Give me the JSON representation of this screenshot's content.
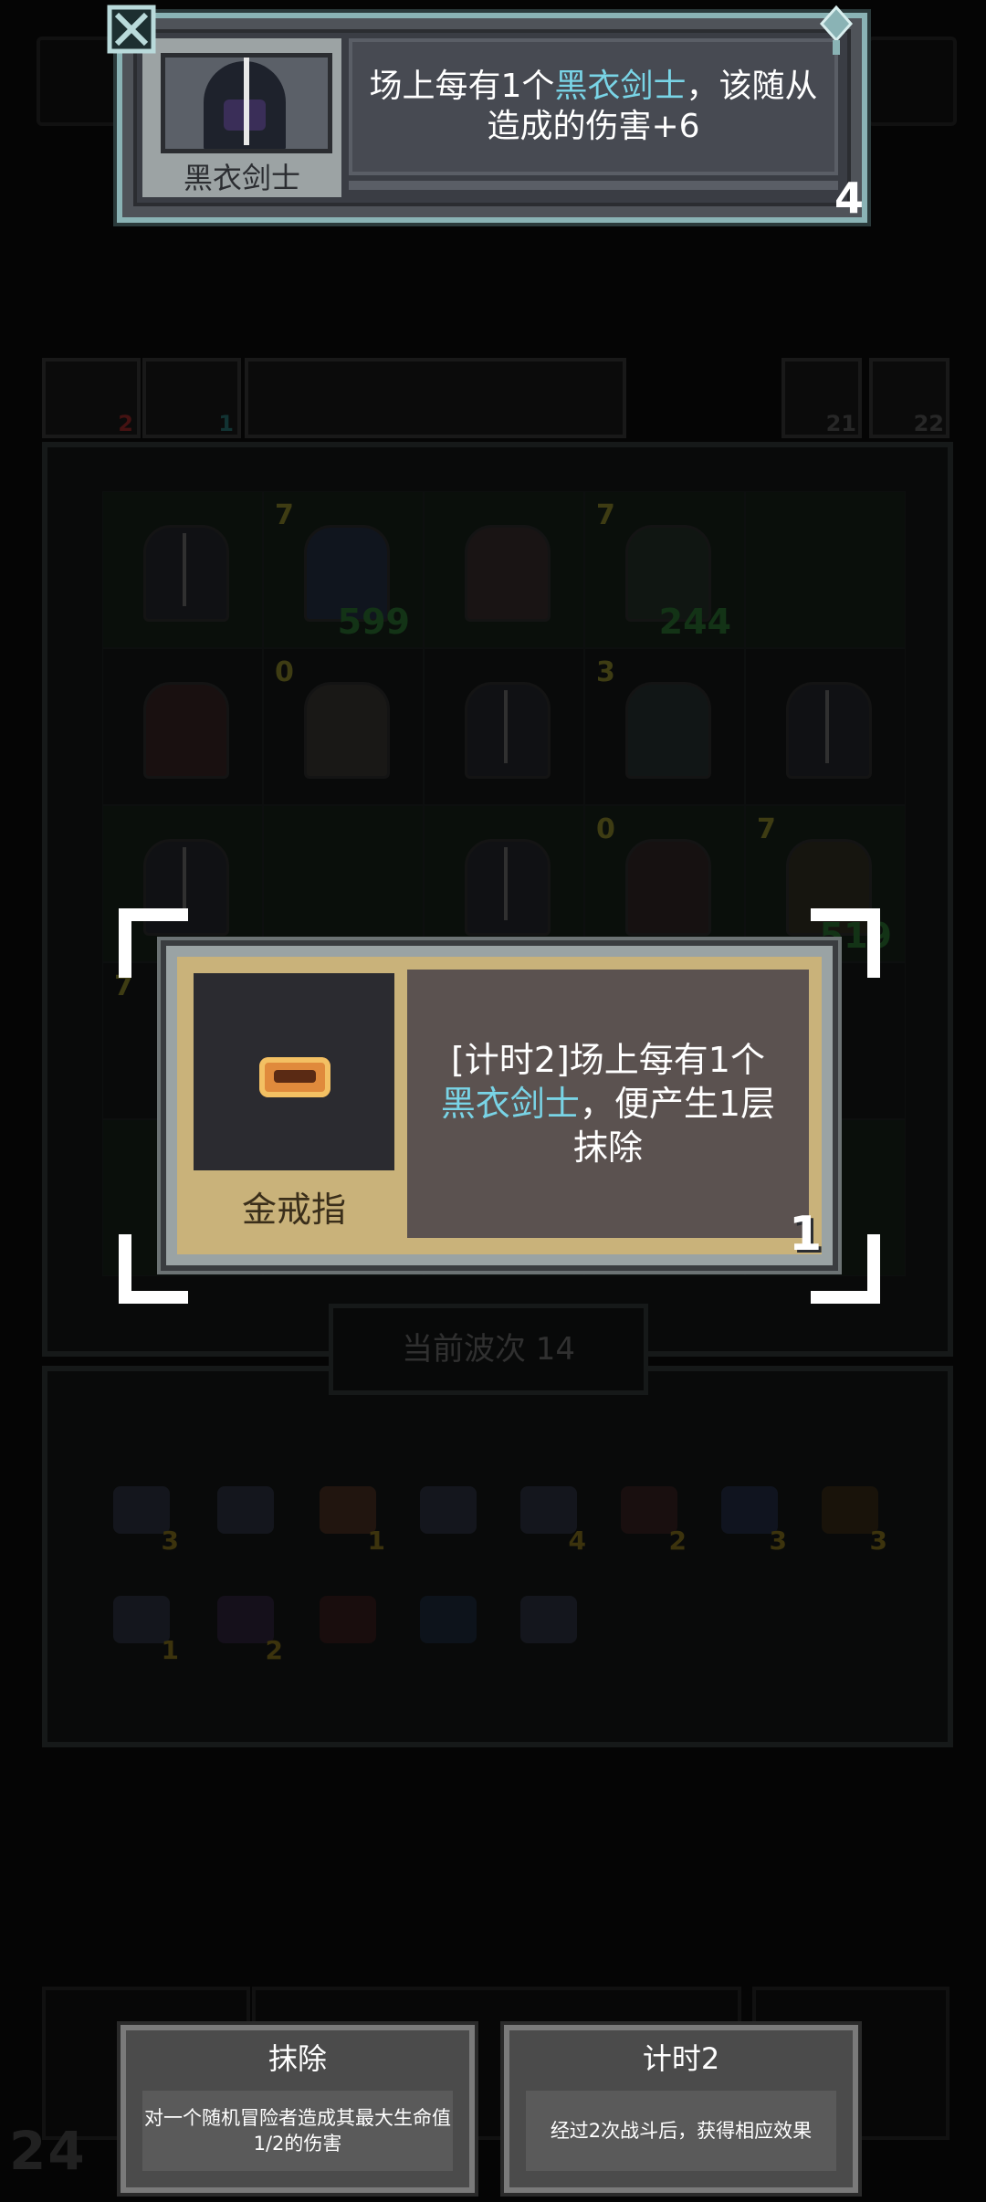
{
  "top_tooltip": {
    "unit_name": "黑衣剑士",
    "desc_part1": "场上每有1个",
    "desc_highlight": "黑衣剑士",
    "desc_part2": "，该随从造成的伤害+6",
    "stack_count": "4"
  },
  "item_tooltip": {
    "item_name": "金戒指",
    "desc_part1": "[计时2]场上每有1个",
    "desc_highlight": "黑衣剑士",
    "desc_part2": "，便产生1层抹除",
    "stack_count": "1"
  },
  "keywords": [
    {
      "title": "抹除",
      "desc": "对一个随机冒险者造成其最大生命值1/2的伤害"
    },
    {
      "title": "计时2",
      "desc": "经过2次战斗后，获得相应效果"
    }
  ],
  "background": {
    "resources": {
      "left_a": "2",
      "left_b": "1",
      "right_a": "21",
      "right_b": "22"
    },
    "board_levels": [
      "7",
      "7",
      "0",
      "3",
      "0",
      "7",
      "7"
    ],
    "board_hp": [
      "599",
      "244",
      "519"
    ],
    "wave_label": "当前波次 14",
    "inventory_counts": [
      "3",
      "1",
      "4",
      "2",
      "3",
      "3",
      "1",
      "2"
    ],
    "turn_counter": "24"
  },
  "colors": {
    "highlight": "#79d4e6",
    "card_frame": "#8ab3b5",
    "item_card_bg": "#c9b27a"
  }
}
